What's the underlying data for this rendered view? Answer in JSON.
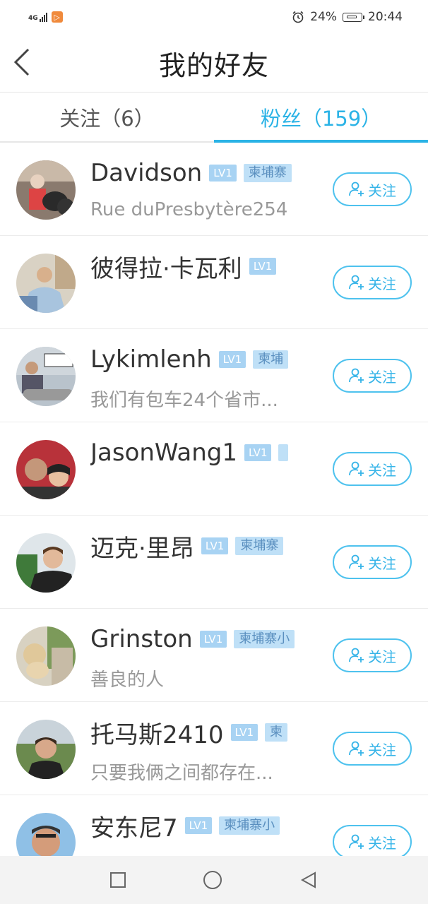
{
  "status_bar": {
    "network": "4G",
    "battery": "24%",
    "time": "20:44"
  },
  "header": {
    "title": "我的好友"
  },
  "tabs": [
    {
      "label": "关注（6）",
      "active": false
    },
    {
      "label": "粉丝（159）",
      "active": true
    }
  ],
  "follow_label": "关注",
  "friends": [
    {
      "name": "Davidson",
      "level": "LV1",
      "location": "柬埔寨",
      "desc": "Rue duPresbytère254"
    },
    {
      "name": "彼得拉·卡瓦利",
      "level": "LV1",
      "location": "",
      "desc": ""
    },
    {
      "name": "Lykimlenh",
      "level": "LV1",
      "location": "柬埔",
      "desc": "我们有包车24个省市..."
    },
    {
      "name": "JasonWang1",
      "level": "LV1",
      "location": "",
      "desc": ""
    },
    {
      "name": "迈克·里昂",
      "level": "LV1",
      "location": "柬埔寨",
      "desc": ""
    },
    {
      "name": "Grinston",
      "level": "LV1",
      "location": "柬埔寨小",
      "desc": "善良的人"
    },
    {
      "name": "托马斯2410",
      "level": "LV1",
      "location": "柬",
      "desc": "只要我俩之间都存在..."
    },
    {
      "name": "安东尼7",
      "level": "LV1",
      "location": "柬埔寨小",
      "desc": ""
    }
  ],
  "colors": {
    "accent": "#2bb3e6",
    "level_badge": "#a8d3f3",
    "location_badge": "#bfe0f7"
  }
}
